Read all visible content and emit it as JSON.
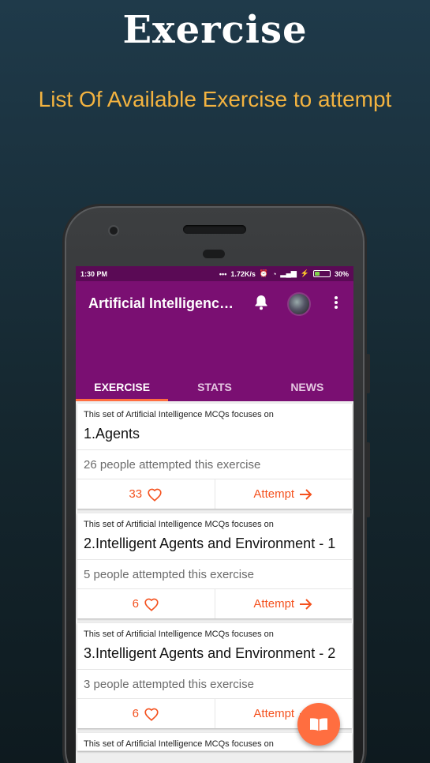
{
  "promo": {
    "title": "Exercise",
    "subtitle": "List Of Available Exercise to attempt"
  },
  "status_bar": {
    "time": "1:30 PM",
    "network_speed": "1.72K/s",
    "battery": "30%",
    "battery_level": 0.3
  },
  "app_bar": {
    "title": "Artificial Intelligence MCQ",
    "notification_icon": "bell-icon",
    "menu_icon": "more-vert-icon"
  },
  "tabs": [
    {
      "label": "EXERCISE",
      "active": true
    },
    {
      "label": "STATS",
      "active": false
    },
    {
      "label": "NEWS",
      "active": false
    }
  ],
  "exercises": [
    {
      "description": "This set of Artificial Intelligence MCQs focuses on",
      "title": "1.Agents",
      "attempts": "26 people attempted this exercise",
      "likes": "33",
      "action": "Attempt"
    },
    {
      "description": "This set of Artificial Intelligence MCQs focuses on",
      "title": "2.Intelligent Agents and Environment - 1",
      "attempts": "5 people attempted this exercise",
      "likes": "6",
      "action": "Attempt"
    },
    {
      "description": "This set of Artificial Intelligence MCQs focuses on",
      "title": "3.Intelligent Agents and Environment - 2",
      "attempts": "3 people attempted this exercise",
      "likes": "6",
      "action": "Attempt"
    },
    {
      "description": "This set of Artificial Intelligence MCQs focuses on"
    }
  ],
  "fab": {
    "icon": "book-icon"
  },
  "colors": {
    "app_bar": "#7a0f72",
    "status_bar": "#5a0a55",
    "accent": "#f4511e",
    "promo_subtitle": "#f3b340"
  }
}
